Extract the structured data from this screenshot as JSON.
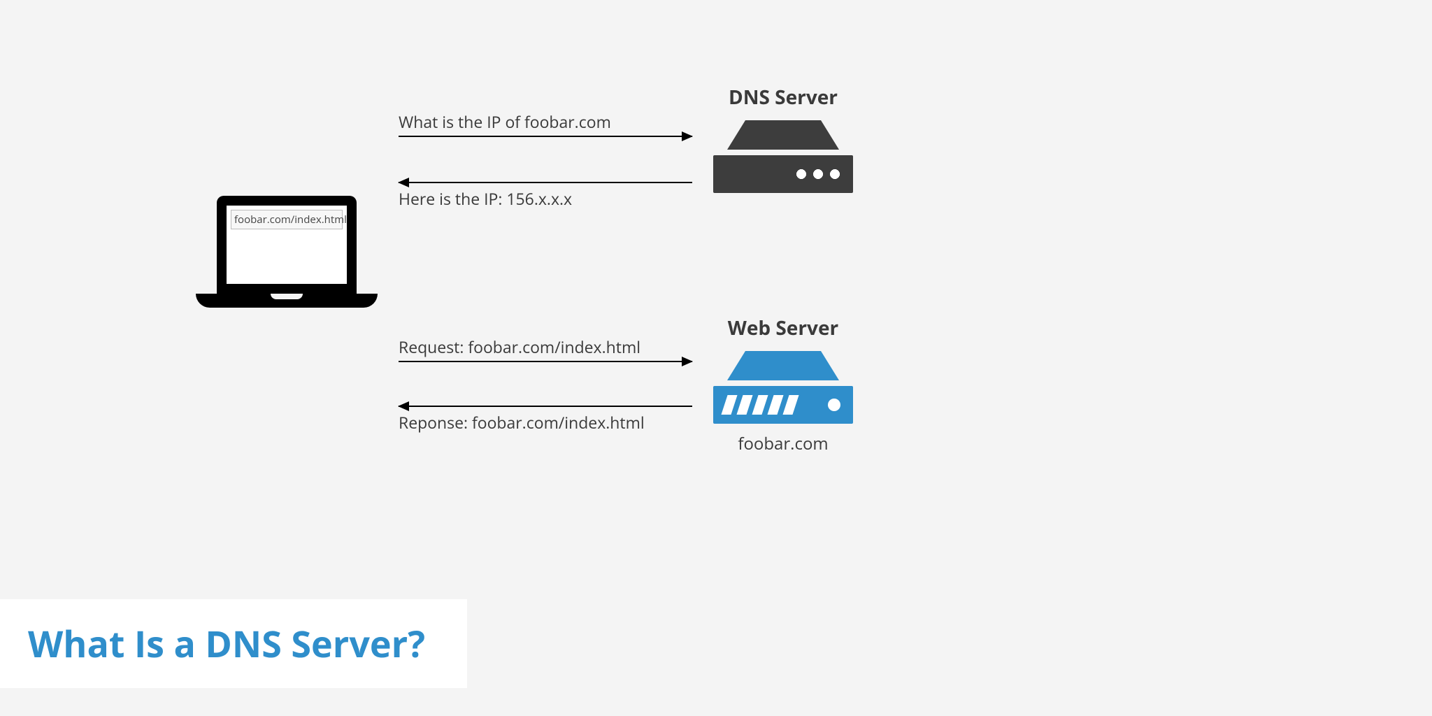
{
  "laptop": {
    "url": "foobar.com/index.html"
  },
  "dns": {
    "label": "DNS Server"
  },
  "web": {
    "label": "Web Server",
    "domain": "foobar.com"
  },
  "arrows": {
    "q_ip": "What is the IP of foobar.com",
    "a_ip": "Here is the IP: 156.x.x.x",
    "req": "Request: foobar.com/index.html",
    "res": "Reponse: foobar.com/index.html"
  },
  "title": "What Is a DNS Server?"
}
